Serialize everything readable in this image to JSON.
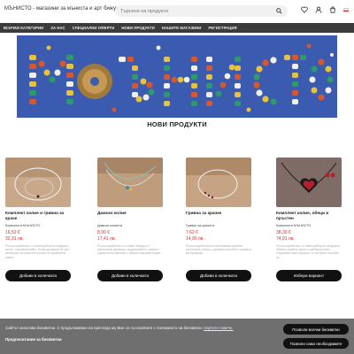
{
  "header": {
    "brand": "МЪНИСТО - магазини за мъниста и арт бижута",
    "search_placeholder": "Търсене на продукти",
    "icons": [
      "search-icon",
      "heart-icon",
      "user-icon",
      "cart-icon",
      "bg-flag-icon"
    ],
    "flag_colors": [
      "#ffffff",
      "#00966e",
      "#d62612"
    ]
  },
  "nav": {
    "items": [
      "ВСИЧКИ КАТЕГОРИИ",
      "ЗА НАС",
      "СПЕЦИАЛНИ ОФЕРТИ",
      "НОВИ ПРОДУКТИ",
      "НАШИТЕ МАГАЗИНИ",
      "РЕГИСТРАЦИЯ"
    ]
  },
  "banner": {
    "logo_text": "мънисто",
    "background_color": "#3a5bb0"
  },
  "section_title": "НОВИ ПРОДУКТИ",
  "products": [
    {
      "name": "Комплект колие и гривна за краче",
      "category": "Комплекти МЪНИСТО",
      "price_eur": "16,52 €",
      "price_bgn": "32,31 лв.",
      "description": "Ръчно изработено от вити/сребърни пендари с метал, позлатени ваба- Колие дължина 45 см с пипъщите на пръстите в които е изработена рамка.",
      "button": "Добави в количката"
    },
    {
      "name": "Дамско колие",
      "category": "Дамски колиета",
      "price_eur": "8,90 €",
      "price_bgn": "17,41 лв.",
      "description": "Ръчно изработено от копия пендари и синтетична мрежица, поддържайте с линия и изразителни цветове с нежна и висулка в цвят.",
      "button": "Добави в количката"
    },
    {
      "name": "Гривна за крачке",
      "category": "Гривни за крачета",
      "price_eur": "7,62 €",
      "price_bgn": "14,90 лв.",
      "description": "Ръчно изработена от виетнамски гранати, синтетичен конец с дължина пособия в правила ма мрежица.",
      "button": "Добави в количката"
    },
    {
      "name": "Комплект колие, обеци и пръстен",
      "category": "Комплекти МЪНИСТО",
      "price_eur": "38,30 €",
      "price_bgn": "74,91 лв.",
      "description": "Ръчно изработено от вити/сребърни пендари и нежни и кожена пукла и сребърна кожа. Сърцевите във сърцата с и пъстрите пособия се.",
      "button": "Избери вариант"
    }
  ],
  "cookie": {
    "text": "Сайтът използва бисквитки. С продължаване на прегледа му Вие се съгласявате с ползването на бисквитки.",
    "link": "Научете повече.",
    "preferences": "Предпочитания за бисквитки",
    "accept_all": "Позволи всички бисквитки",
    "necessary_only": "Позволи само необходимите"
  }
}
